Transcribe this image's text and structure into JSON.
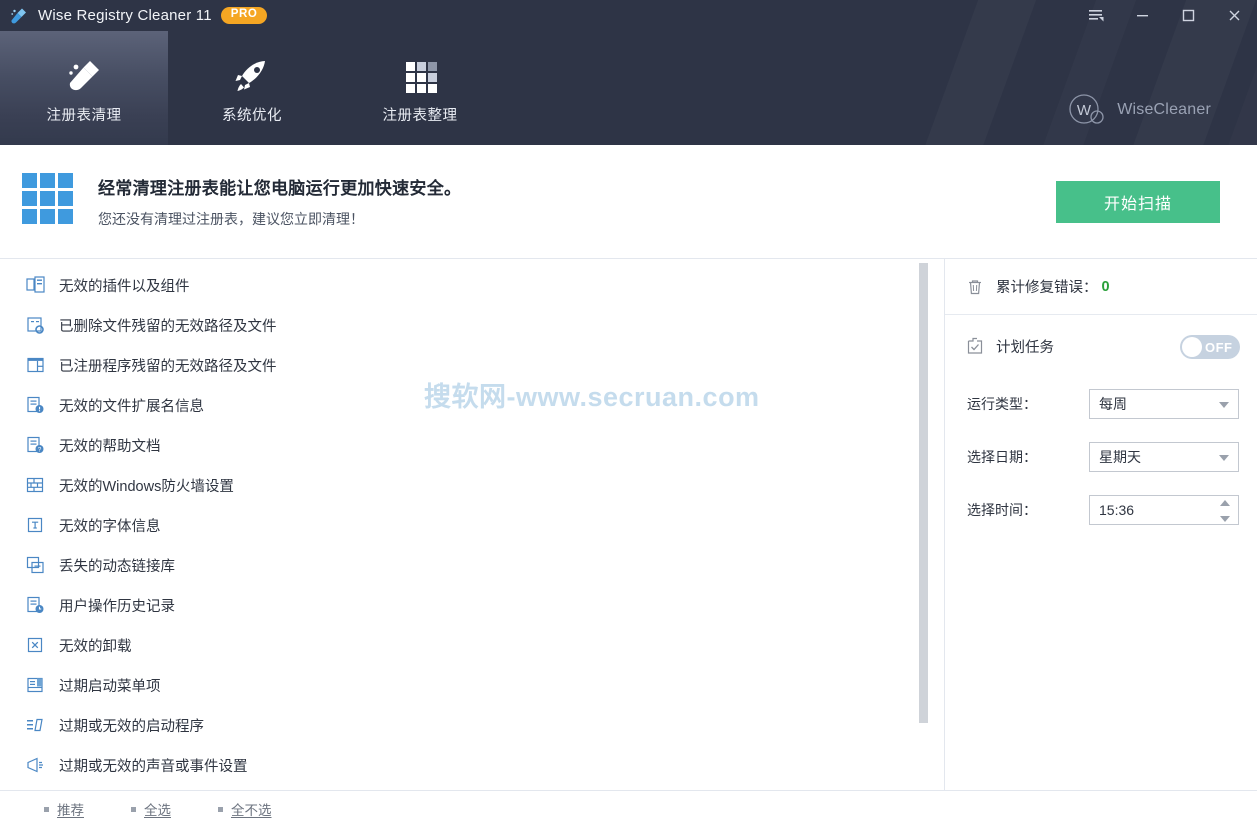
{
  "window": {
    "title": "Wise Registry Cleaner 11",
    "badge": "PRO",
    "app_icon": "broom-icon",
    "controls": [
      {
        "name": "menu-button",
        "icon": "menu-icon",
        "glyph": ""
      },
      {
        "name": "minimize-button",
        "icon": "minimize-icon",
        "glyph": "—"
      },
      {
        "name": "maximize-button",
        "icon": "maximize-icon",
        "glyph": "□"
      },
      {
        "name": "close-button",
        "icon": "close-icon",
        "glyph": "✕"
      }
    ]
  },
  "nav": {
    "tabs": [
      {
        "label": "注册表清理",
        "icon": "broom-icon",
        "active": true
      },
      {
        "label": "系统优化",
        "icon": "rocket-icon",
        "active": false
      },
      {
        "label": "注册表整理",
        "icon": "grid-icon",
        "active": false
      }
    ]
  },
  "brand": {
    "logo": "wisecleaner-logo-icon",
    "text": "WiseCleaner",
    "mark": "W"
  },
  "banner": {
    "icon": "grid-blue-icon",
    "title": "经常清理注册表能让您电脑运行更加快速安全。",
    "subtitle": "您还没有清理过注册表，建议您立即清理！",
    "scan_button": "开始扫描",
    "accent_color": "#47c08a"
  },
  "watermark": "搜软网-www.secruan.com",
  "list": {
    "items": [
      {
        "label": "无效的插件以及组件",
        "icon": "plugin-components-icon"
      },
      {
        "label": "已删除文件残留的无效路径及文件",
        "icon": "deleted-file-residue-icon"
      },
      {
        "label": "已注册程序残留的无效路径及文件",
        "icon": "registered-program-residue-icon"
      },
      {
        "label": "无效的文件扩展名信息",
        "icon": "file-extension-warning-icon"
      },
      {
        "label": "无效的帮助文档",
        "icon": "help-document-icon"
      },
      {
        "label": "无效的Windows防火墙设置",
        "icon": "firewall-icon"
      },
      {
        "label": "无效的字体信息",
        "icon": "font-icon"
      },
      {
        "label": "丢失的动态链接库",
        "icon": "dll-icon"
      },
      {
        "label": "用户操作历史记录",
        "icon": "history-icon"
      },
      {
        "label": "无效的卸载",
        "icon": "uninstall-icon"
      },
      {
        "label": "过期启动菜单项",
        "icon": "start-menu-icon"
      },
      {
        "label": "过期或无效的启动程序",
        "icon": "startup-program-icon"
      },
      {
        "label": "过期或无效的声音或事件设置",
        "icon": "sound-event-icon"
      }
    ]
  },
  "sidebar": {
    "fixed_errors": {
      "icon": "trash-icon",
      "label": "累计修复错误：",
      "count": "0",
      "count_color": "#2aa03a"
    },
    "scheduled_task": {
      "icon": "task-check-icon",
      "label": "计划任务",
      "toggle_state": "OFF"
    },
    "fields": [
      {
        "label": "运行类型：",
        "value": "每周",
        "control": "select",
        "name": "run-type-select"
      },
      {
        "label": "选择日期：",
        "value": "星期天",
        "control": "select",
        "name": "run-day-select"
      },
      {
        "label": "选择时间：",
        "value": "15:36",
        "control": "spinner",
        "name": "run-time-spinner"
      }
    ]
  },
  "footer": {
    "links": [
      {
        "label": "推荐",
        "name": "recommend-link"
      },
      {
        "label": "全选",
        "name": "select-all-link"
      },
      {
        "label": "全不选",
        "name": "select-none-link"
      }
    ]
  }
}
